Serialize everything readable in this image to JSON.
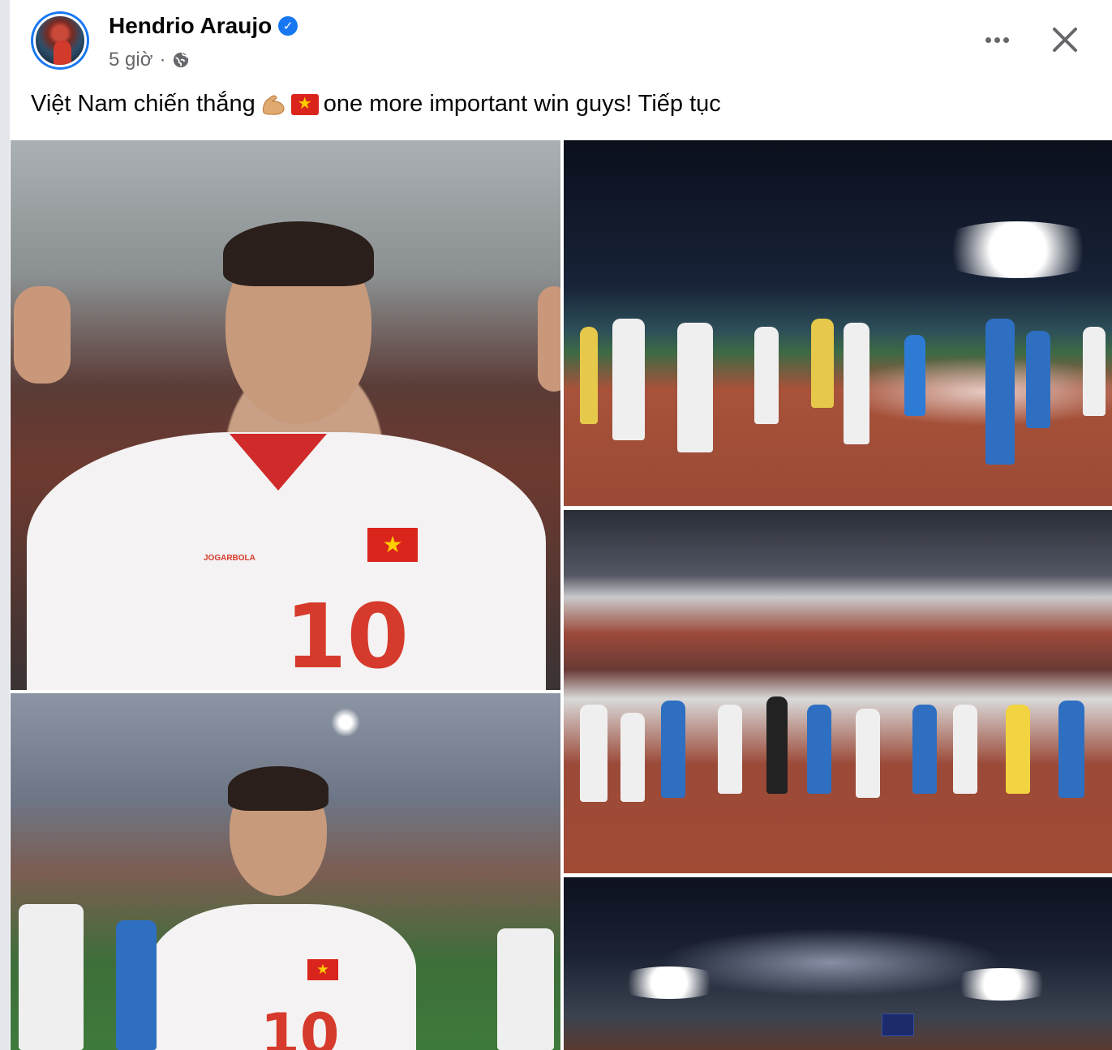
{
  "post": {
    "author_name": "Hendrio Araujo",
    "verified_icon": "verified-badge-icon",
    "time": "5 giờ",
    "separator": "·",
    "privacy_icon": "globe-icon",
    "text_before_emoji": "Việt Nam chiến thắng",
    "emoji_1": "flexed-biceps-emoji",
    "emoji_2": "vietnam-flag-emoji",
    "text_after_emoji": "one more important win guys! Tiếp tục",
    "more_icon": "more-options-icon",
    "close_icon": "close-icon"
  },
  "photos": {
    "photo_1": {
      "jersey_number": "10",
      "sponsor": "JOGARBOLA"
    },
    "photo_4": {
      "jersey_number": "10"
    }
  },
  "colors": {
    "verified_blue": "#1877f2",
    "secondary_text": "#65676b",
    "primary_text": "#050505",
    "jersey_red": "#d12a2a"
  }
}
